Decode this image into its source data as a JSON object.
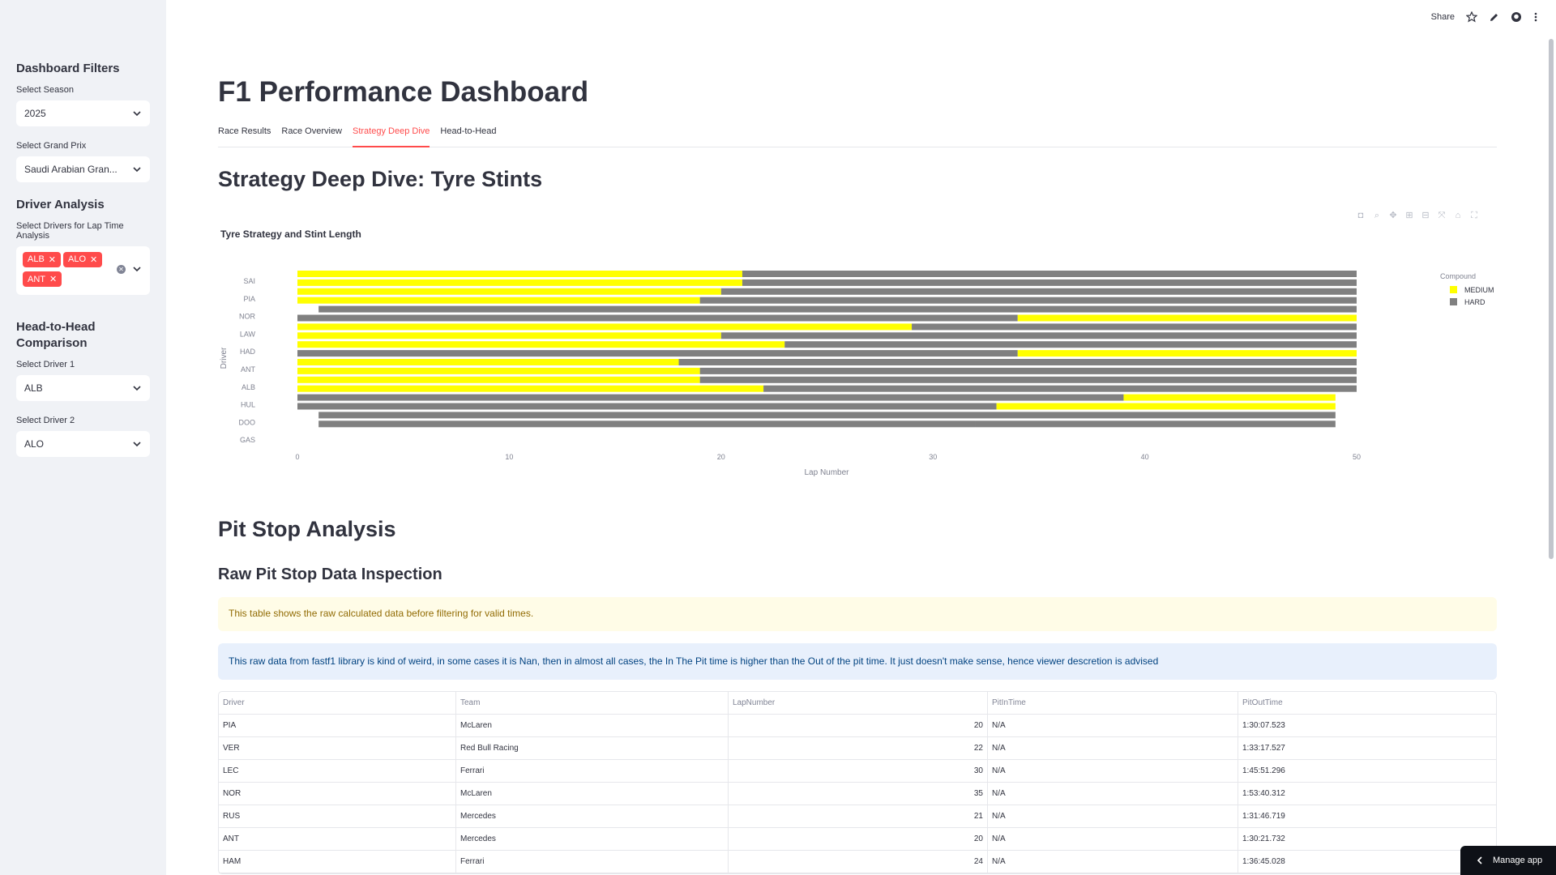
{
  "sidebar": {
    "filters_title": "Dashboard Filters",
    "season_label": "Select Season",
    "season_value": "2025",
    "gp_label": "Select Grand Prix",
    "gp_value": "Saudi Arabian Gran...",
    "driver_analysis_title": "Driver Analysis",
    "drivers_label": "Select Drivers for Lap Time Analysis",
    "selected_drivers": [
      "ALB",
      "ALO",
      "ANT"
    ],
    "h2h_title": "Head-to-Head Comparison",
    "driver1_label": "Select Driver 1",
    "driver1_value": "ALB",
    "driver2_label": "Select Driver 2",
    "driver2_value": "ALO"
  },
  "toolbar": {
    "share_label": "Share"
  },
  "app_title": "F1 Performance Dashboard",
  "tabs": [
    "Race Results",
    "Race Overview",
    "Strategy Deep Dive",
    "Head-to-Head"
  ],
  "active_tab": "Strategy Deep Dive",
  "strategy_header": "Strategy Deep Dive: Tyre Stints",
  "chart_data": {
    "type": "bar",
    "orientation": "horizontal",
    "title": "Tyre Strategy and Stint Length",
    "xlabel": "Lap Number",
    "ylabel": "Driver",
    "xlim": [
      0,
      50
    ],
    "xticks": [
      0,
      10,
      20,
      30,
      40,
      50
    ],
    "y_tick_labels": [
      "SAI",
      "PIA",
      "NOR",
      "LAW",
      "HAD",
      "ANT",
      "ALB",
      "HUL",
      "DOO",
      "GAS"
    ],
    "legend_title": "Compound",
    "legend": [
      {
        "name": "MEDIUM",
        "color": "#ffff00"
      },
      {
        "name": "HARD",
        "color": "#808080"
      }
    ],
    "rows": [
      {
        "stints": [
          {
            "c": "MEDIUM",
            "s": 1,
            "e": 21
          },
          {
            "c": "HARD",
            "s": 22,
            "e": 50
          }
        ]
      },
      {
        "stints": [
          {
            "c": "MEDIUM",
            "s": 1,
            "e": 21
          },
          {
            "c": "HARD",
            "s": 22,
            "e": 50
          }
        ]
      },
      {
        "stints": [
          {
            "c": "MEDIUM",
            "s": 1,
            "e": 20
          },
          {
            "c": "HARD",
            "s": 21,
            "e": 50
          }
        ]
      },
      {
        "stints": [
          {
            "c": "MEDIUM",
            "s": 1,
            "e": 19
          },
          {
            "c": "HARD",
            "s": 20,
            "e": 50
          }
        ]
      },
      {
        "stints": [
          {
            "c": "HARD",
            "s": 2,
            "e": 50
          }
        ]
      },
      {
        "stints": [
          {
            "c": "HARD",
            "s": 1,
            "e": 34
          },
          {
            "c": "MEDIUM",
            "s": 35,
            "e": 50
          }
        ]
      },
      {
        "stints": [
          {
            "c": "MEDIUM",
            "s": 1,
            "e": 29
          },
          {
            "c": "HARD",
            "s": 30,
            "e": 50
          }
        ]
      },
      {
        "stints": [
          {
            "c": "MEDIUM",
            "s": 1,
            "e": 20
          },
          {
            "c": "HARD",
            "s": 21,
            "e": 50
          }
        ]
      },
      {
        "stints": [
          {
            "c": "MEDIUM",
            "s": 1,
            "e": 23
          },
          {
            "c": "HARD",
            "s": 24,
            "e": 50
          }
        ]
      },
      {
        "stints": [
          {
            "c": "HARD",
            "s": 1,
            "e": 34
          },
          {
            "c": "MEDIUM",
            "s": 35,
            "e": 50
          }
        ]
      },
      {
        "stints": [
          {
            "c": "MEDIUM",
            "s": 1,
            "e": 18
          },
          {
            "c": "HARD",
            "s": 19,
            "e": 50
          }
        ]
      },
      {
        "stints": [
          {
            "c": "MEDIUM",
            "s": 1,
            "e": 19
          },
          {
            "c": "HARD",
            "s": 20,
            "e": 50
          }
        ]
      },
      {
        "stints": [
          {
            "c": "MEDIUM",
            "s": 1,
            "e": 19
          },
          {
            "c": "HARD",
            "s": 20,
            "e": 50
          }
        ]
      },
      {
        "stints": [
          {
            "c": "MEDIUM",
            "s": 1,
            "e": 22
          },
          {
            "c": "HARD",
            "s": 23,
            "e": 50
          }
        ]
      },
      {
        "stints": [
          {
            "c": "HARD",
            "s": 1,
            "e": 39
          },
          {
            "c": "MEDIUM",
            "s": 40,
            "e": 49
          }
        ]
      },
      {
        "stints": [
          {
            "c": "HARD",
            "s": 1,
            "e": 33
          },
          {
            "c": "MEDIUM",
            "s": 34,
            "e": 49
          }
        ]
      },
      {
        "stints": [
          {
            "c": "HARD",
            "s": 2,
            "e": 49
          }
        ]
      },
      {
        "stints": [
          {
            "c": "HARD",
            "s": 2,
            "e": 32
          },
          {
            "c": "HARD",
            "s": 33,
            "e": 49
          }
        ]
      }
    ]
  },
  "pit_header": "Pit Stop Analysis",
  "raw_header": "Raw Pit Stop Data Inspection",
  "warning_text": "This table shows the raw calculated data before filtering for valid times.",
  "info_text": "This raw data from fastf1 library is kind of weird, in some cases it is Nan, then in almost all cases, the In The Pit time is higher than the Out of the pit time. It just doesn't make sense, hence viewer descretion is advised",
  "table": {
    "columns": [
      "Driver",
      "Team",
      "LapNumber",
      "PitInTime",
      "PitOutTime"
    ],
    "rows": [
      [
        "PIA",
        "McLaren",
        "20",
        "N/A",
        "1:30:07.523"
      ],
      [
        "VER",
        "Red Bull Racing",
        "22",
        "N/A",
        "1:33:17.527"
      ],
      [
        "LEC",
        "Ferrari",
        "30",
        "N/A",
        "1:45:51.296"
      ],
      [
        "NOR",
        "McLaren",
        "35",
        "N/A",
        "1:53:40.312"
      ],
      [
        "RUS",
        "Mercedes",
        "21",
        "N/A",
        "1:31:46.719"
      ],
      [
        "ANT",
        "Mercedes",
        "20",
        "N/A",
        "1:30:21.732"
      ],
      [
        "HAM",
        "Ferrari",
        "24",
        "N/A",
        "1:36:45.028"
      ]
    ]
  },
  "manage_label": "Manage app"
}
